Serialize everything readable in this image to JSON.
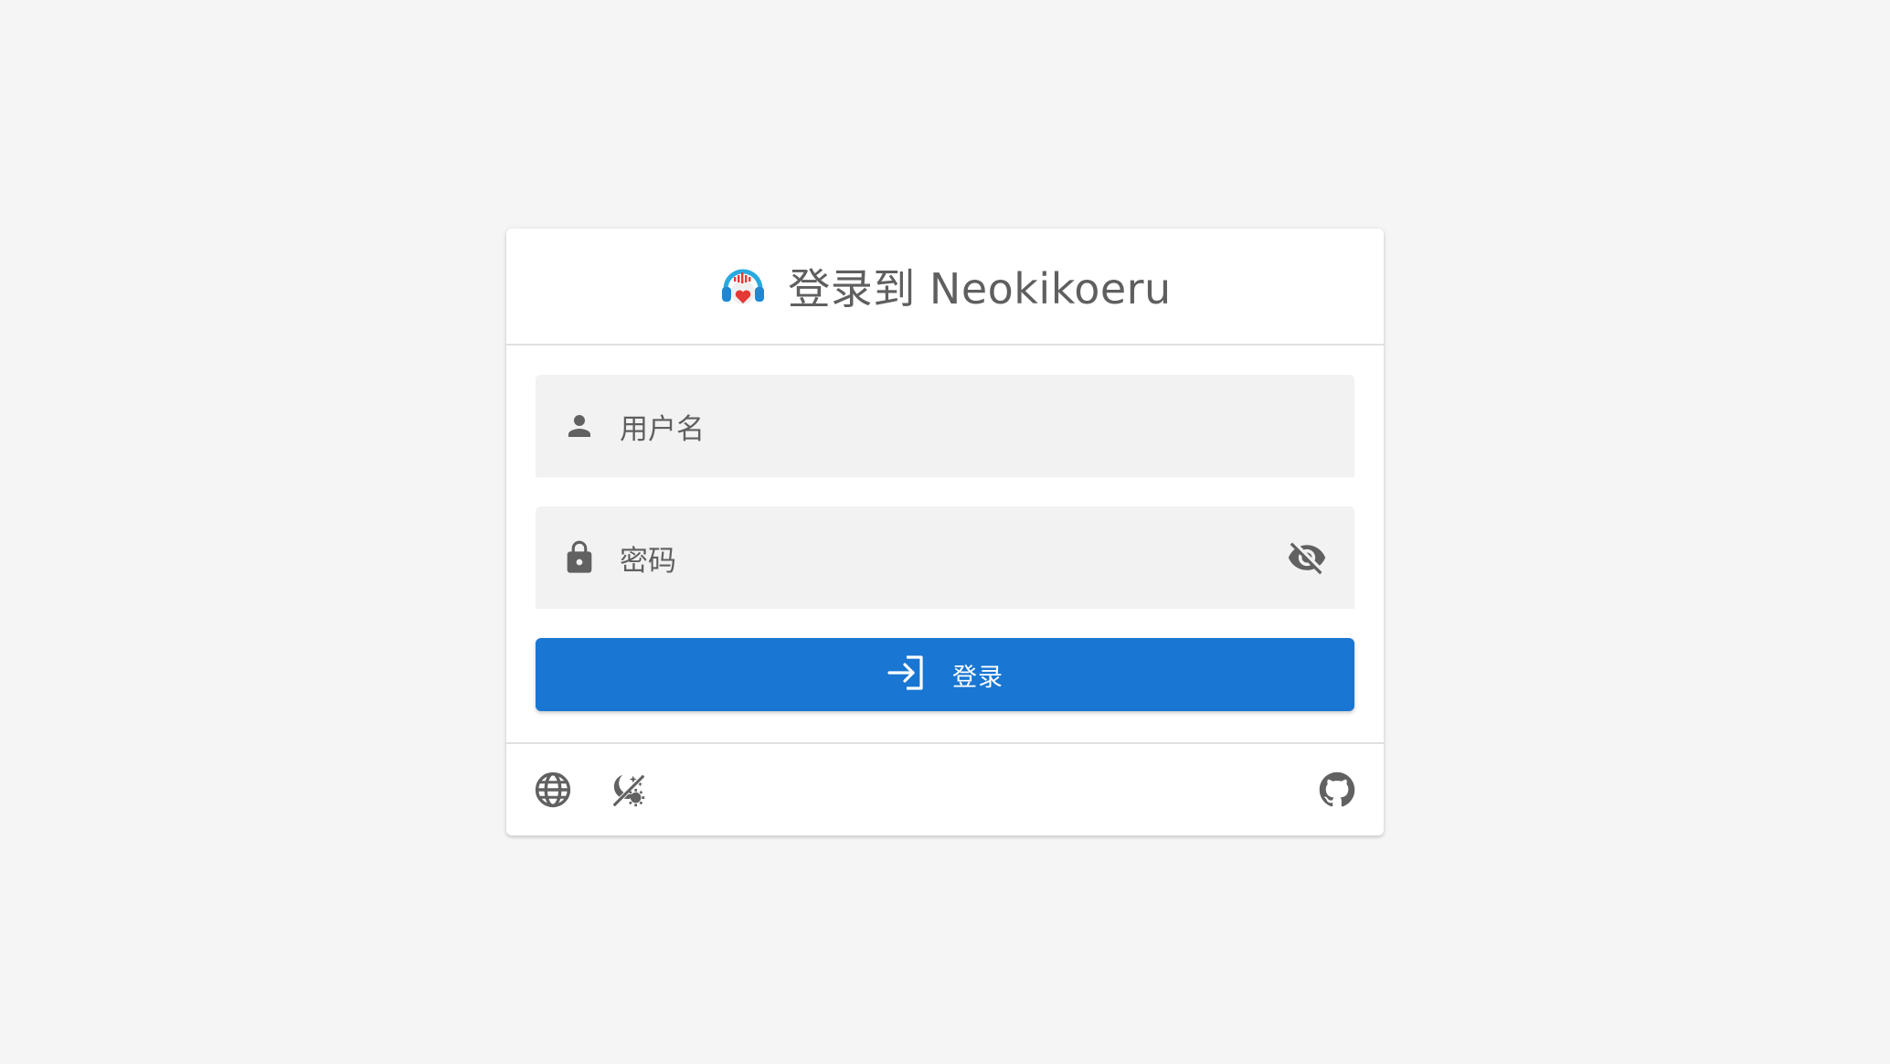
{
  "header": {
    "title": "登录到 Neokikoeru",
    "logo_icon": "headphones-heart-icon"
  },
  "form": {
    "username": {
      "placeholder": "用户名",
      "icon": "person-icon"
    },
    "password": {
      "placeholder": "密码",
      "icon": "lock-icon",
      "toggle_icon": "eye-off-icon"
    },
    "login_button": {
      "label": "登录",
      "icon": "login-icon"
    }
  },
  "footer": {
    "language_icon": "globe-icon",
    "theme_icon": "theme-auto-icon",
    "github_icon": "github-icon"
  },
  "colors": {
    "accent": "#1976d2",
    "background": "#f5f5f5",
    "field_bg": "#f2f2f2",
    "icon": "#616161"
  }
}
